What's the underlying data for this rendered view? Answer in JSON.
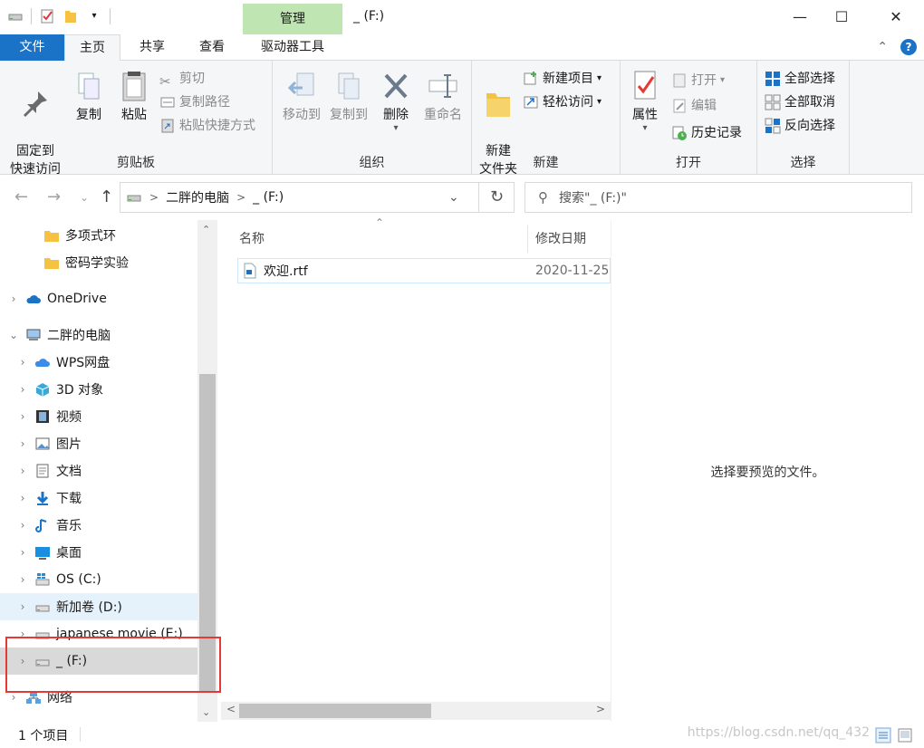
{
  "window": {
    "title": "_ (F:)",
    "context_tab": "管理",
    "controls": {
      "minimize": "—",
      "maximize": "☐",
      "close": "✕"
    }
  },
  "ribbon_tabs": {
    "file": "文件",
    "home": "主页",
    "share": "共享",
    "view": "查看",
    "drive_tools": "驱动器工具"
  },
  "ribbon": {
    "clipboard": {
      "label": "剪贴板",
      "pin": "固定到\n快速访问",
      "copy": "复制",
      "paste": "粘贴",
      "cut": "剪切",
      "copy_path": "复制路径",
      "paste_shortcut": "粘贴快捷方式"
    },
    "organize": {
      "label": "组织",
      "move_to": "移动到",
      "copy_to": "复制到",
      "delete": "删除",
      "rename": "重命名"
    },
    "new": {
      "label": "新建",
      "new_folder": "新建\n文件夹",
      "new_item": "新建项目",
      "easy_access": "轻松访问"
    },
    "open": {
      "label": "打开",
      "properties": "属性",
      "open": "打开",
      "edit": "编辑",
      "history": "历史记录"
    },
    "select": {
      "label": "选择",
      "select_all": "全部选择",
      "select_none": "全部取消",
      "invert": "反向选择"
    }
  },
  "address": {
    "crumbs": [
      "二胖的电脑",
      "_ (F:)"
    ],
    "search_placeholder": "搜索\"_ (F:)\""
  },
  "nav": {
    "items": [
      {
        "label": "多项式环",
        "icon": "folder-icon",
        "indent": 2,
        "chev": ""
      },
      {
        "label": "密码学实验",
        "icon": "folder-icon",
        "indent": 2,
        "chev": ""
      },
      {
        "label": "OneDrive",
        "icon": "cloud-icon",
        "indent": 0,
        "chev": ">"
      },
      {
        "label": "二胖的电脑",
        "icon": "computer-icon",
        "indent": 0,
        "chev": "v"
      },
      {
        "label": "WPS网盘",
        "icon": "wps-cloud-icon",
        "indent": 1,
        "chev": ">"
      },
      {
        "label": "3D 对象",
        "icon": "cube-icon",
        "indent": 1,
        "chev": ">"
      },
      {
        "label": "视频",
        "icon": "film-icon",
        "indent": 1,
        "chev": ">"
      },
      {
        "label": "图片",
        "icon": "picture-icon",
        "indent": 1,
        "chev": ">"
      },
      {
        "label": "文档",
        "icon": "document-icon",
        "indent": 1,
        "chev": ">"
      },
      {
        "label": "下载",
        "icon": "download-icon",
        "indent": 1,
        "chev": ">"
      },
      {
        "label": "音乐",
        "icon": "music-icon",
        "indent": 1,
        "chev": ">"
      },
      {
        "label": "桌面",
        "icon": "desktop-icon",
        "indent": 1,
        "chev": ">"
      },
      {
        "label": "OS (C:)",
        "icon": "windows-drive-icon",
        "indent": 1,
        "chev": ">"
      },
      {
        "label": "新加卷 (D:)",
        "icon": "drive-icon",
        "indent": 1,
        "chev": ">"
      },
      {
        "label": "japanese movie (E:)",
        "icon": "drive-icon",
        "indent": 1,
        "chev": ">"
      },
      {
        "label": "_ (F:)",
        "icon": "drive-icon",
        "indent": 1,
        "chev": ">"
      },
      {
        "label": "网络",
        "icon": "network-icon",
        "indent": 0,
        "chev": ">"
      }
    ]
  },
  "content": {
    "columns": {
      "name": "名称",
      "modified": "修改日期"
    },
    "files": [
      {
        "name": "欢迎.rtf",
        "modified": "2020-11-25"
      }
    ]
  },
  "preview": {
    "empty_text": "选择要预览的文件。"
  },
  "status": {
    "count": "1 个项目",
    "watermark": "https://blog.csdn.net/qq_432"
  },
  "colors": {
    "accent": "#1a73c7",
    "manage": "#bfe5b3",
    "highlight": "#e53935"
  }
}
